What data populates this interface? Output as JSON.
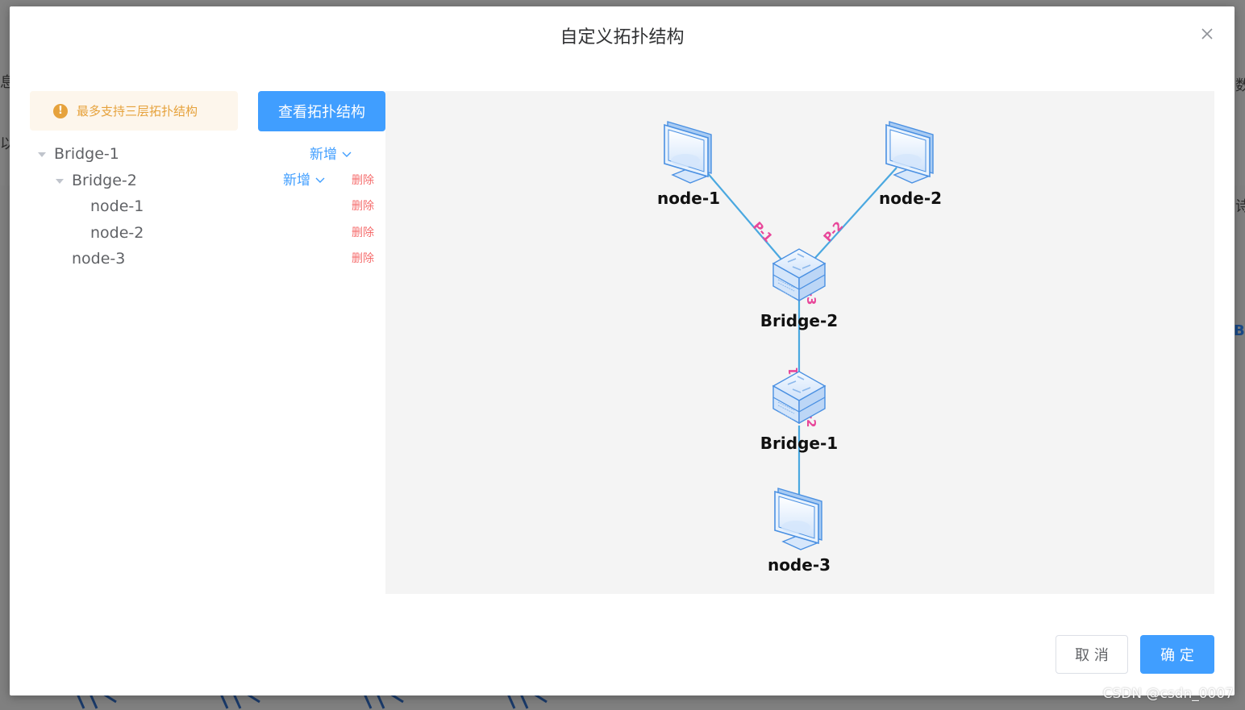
{
  "dialog": {
    "title": "自定义拓扑结构",
    "close_icon": "close-icon"
  },
  "tip": {
    "icon": "warning-circle-icon",
    "text": "最多支持三层拓扑结构"
  },
  "view_button": {
    "label": "查看拓扑结构"
  },
  "tree": {
    "items": [
      {
        "label": "Bridge-1",
        "level": 0,
        "expanded": true,
        "add_label": "新增",
        "delete_label": ""
      },
      {
        "label": "Bridge-2",
        "level": 1,
        "expanded": true,
        "add_label": "新增",
        "delete_label": "删除"
      },
      {
        "label": "node-1",
        "level": 2,
        "expanded": false,
        "add_label": "",
        "delete_label": "删除"
      },
      {
        "label": "node-2",
        "level": 2,
        "expanded": false,
        "add_label": "",
        "delete_label": "删除"
      },
      {
        "label": "node-3",
        "level": 1,
        "expanded": false,
        "add_label": "",
        "delete_label": "删除"
      }
    ]
  },
  "topology": {
    "nodes": [
      {
        "id": "node-1",
        "label": "node-1",
        "kind": "computer"
      },
      {
        "id": "node-2",
        "label": "node-2",
        "kind": "computer"
      },
      {
        "id": "bridge-2",
        "label": "Bridge-2",
        "kind": "switch"
      },
      {
        "id": "bridge-1",
        "label": "Bridge-1",
        "kind": "switch"
      },
      {
        "id": "node-3",
        "label": "node-3",
        "kind": "computer"
      }
    ],
    "links": [
      {
        "from": "node-1",
        "to": "bridge-2",
        "port_label": "P-1"
      },
      {
        "from": "node-2",
        "to": "bridge-2",
        "port_label": "P-2"
      },
      {
        "from": "bridge-2",
        "to": "bridge-1",
        "port_label": "P-3"
      },
      {
        "from": "bridge-1",
        "to": "bridge-2",
        "port_label": "P-1"
      },
      {
        "from": "bridge-1",
        "to": "node-3",
        "port_label": "P-2"
      }
    ],
    "link_color": "#4aa8e0",
    "port_label_color": "#e8479a"
  },
  "footer": {
    "cancel_label": "取 消",
    "ok_label": "确 定"
  },
  "background": {
    "left_text_1": "息",
    "left_text_2": "以",
    "right_text_1": "数",
    "right_text_2": "诗",
    "right_text_3": "Br"
  },
  "watermark": "CSDN @csdn_0007",
  "colors": {
    "primary": "#409eff",
    "danger": "#f56c6c",
    "warning": "#e6a23c",
    "warning_bg": "#fdf6ec"
  }
}
